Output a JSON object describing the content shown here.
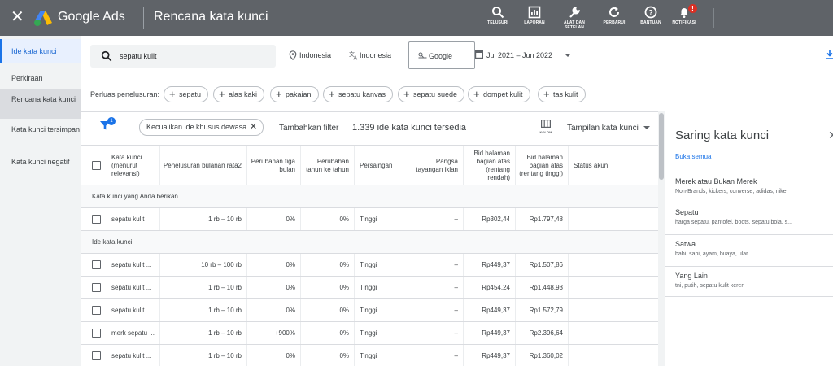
{
  "topbar": {
    "brand": "Google Ads",
    "page_title": "Rencana kata kunci",
    "actions": [
      {
        "label": "TELUSURI",
        "icon": "search-icon"
      },
      {
        "label": "LAPORAN",
        "icon": "reports-icon"
      },
      {
        "label": "ALAT DAN SETELAN",
        "icon": "wrench-icon"
      },
      {
        "label": "PERBARUI",
        "icon": "refresh-icon"
      },
      {
        "label": "BANTUAN",
        "icon": "help-icon"
      },
      {
        "label": "NOTIFIKASI",
        "icon": "bell-icon"
      }
    ],
    "notif_badge": "!"
  },
  "sidebar": {
    "items": [
      {
        "label": "Ide kata kunci"
      },
      {
        "label": "Perkiraan"
      },
      {
        "label": "Rencana kata kunci"
      },
      {
        "label": "Kata kunci tersimpan"
      },
      {
        "label": "Kata kunci negatif"
      }
    ]
  },
  "search": {
    "value": "sepatu kulit",
    "location": "Indonesia",
    "language": "Indonesia",
    "network": "Google",
    "date_range": "Jul 2021 – Jun 2022"
  },
  "expand": {
    "label": "Perluas penelusuran:",
    "chips": [
      "sepatu",
      "alas kaki",
      "pakaian",
      "sepatu kanvas",
      "sepatu suede",
      "dompet kulit",
      "tas kulit"
    ]
  },
  "table_toolbar": {
    "filter_badge": "1",
    "exclude_chip": "Kecualikan ide khusus dewasa",
    "add_filter": "Tambahkan filter",
    "idea_count": "1.339 ide kata kunci tersedia",
    "columns_label": "KOLOM",
    "view_label": "Tampilan kata kunci"
  },
  "table": {
    "headers": [
      "Kata kunci (menurut relevansi)",
      "Penelusuran bulanan rata2",
      "Perubahan tiga bulan",
      "Perubahan tahun ke tahun",
      "Persaingan",
      "Pangsa tayangan iklan",
      "Bid halaman bagian atas (rentang rendah)",
      "Bid halaman bagian atas (rentang tinggi)",
      "Status akun"
    ],
    "group1_label": "Kata kunci yang Anda berikan",
    "group2_label": "Ide kata kunci",
    "provided_rows": [
      [
        "sepatu kulit",
        "1 rb – 10 rb",
        "0%",
        "0%",
        "Tinggi",
        "–",
        "Rp302,44",
        "Rp1.797,48",
        ""
      ]
    ],
    "idea_rows": [
      [
        "sepatu kulit ...",
        "10 rb – 100 rb",
        "0%",
        "0%",
        "Tinggi",
        "–",
        "Rp449,37",
        "Rp1.507,86",
        ""
      ],
      [
        "sepatu kulit ...",
        "1 rb – 10 rb",
        "0%",
        "0%",
        "Tinggi",
        "–",
        "Rp454,24",
        "Rp1.448,93",
        ""
      ],
      [
        "sepatu kulit ...",
        "1 rb – 10 rb",
        "0%",
        "0%",
        "Tinggi",
        "–",
        "Rp449,37",
        "Rp1.572,79",
        ""
      ],
      [
        "merk sepatu ...",
        "1 rb – 10 rb",
        "+900%",
        "0%",
        "Tinggi",
        "–",
        "Rp449,37",
        "Rp2.396,64",
        ""
      ],
      [
        "sepatu kulit ...",
        "1 rb – 10 rb",
        "0%",
        "0%",
        "Tinggi",
        "–",
        "Rp449,37",
        "Rp1.360,02",
        ""
      ]
    ]
  },
  "refine": {
    "title": "Saring kata kunci",
    "open_all": "Buka semua",
    "groups": [
      {
        "title": "Merek atau Bukan Merek",
        "items": "Non-Brands, kickers, converse, adidas, nike"
      },
      {
        "title": "Sepatu",
        "items": "harga sepatu, pantofel, boots, sepatu bola, s..."
      },
      {
        "title": "Satwa",
        "items": "babi, sapi, ayam, buaya, ular"
      },
      {
        "title": "Yang Lain",
        "items": "tni, putih, sepatu kulit keren"
      }
    ]
  },
  "colors": {
    "topbar": "#5f6368",
    "accent": "#1a73e8",
    "sidebar": "#f1f3f4",
    "badge": "#d93025"
  }
}
